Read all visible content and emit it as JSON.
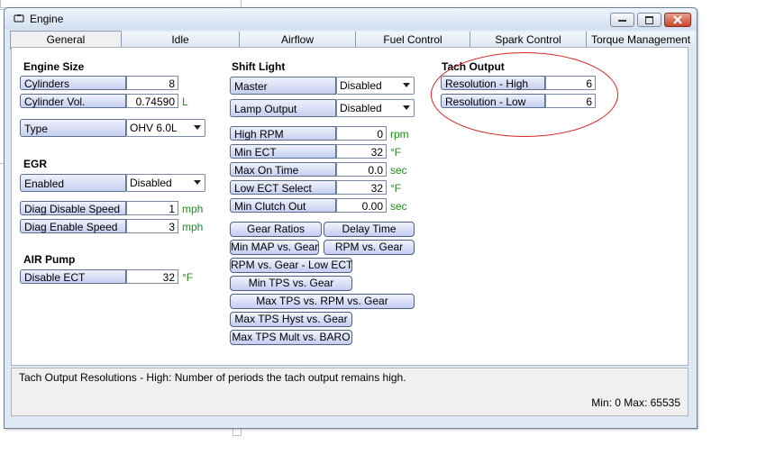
{
  "window": {
    "title": "Engine"
  },
  "tabs": [
    "General",
    "Idle",
    "Airflow",
    "Fuel Control",
    "Spark Control",
    "Torque Management"
  ],
  "engine_size": {
    "heading": "Engine Size",
    "cylinders": {
      "label": "Cylinders",
      "value": "8"
    },
    "cylinder_vol": {
      "label": "Cylinder Vol.",
      "value": "0.74590",
      "unit": "L"
    },
    "type": {
      "label": "Type",
      "value": "OHV 6.0L"
    }
  },
  "egr": {
    "heading": "EGR",
    "enabled": {
      "label": "Enabled",
      "value": "Disabled"
    },
    "diag_disable_speed": {
      "label": "Diag Disable Speed",
      "value": "1",
      "unit": "mph"
    },
    "diag_enable_speed": {
      "label": "Diag Enable Speed",
      "value": "3",
      "unit": "mph"
    }
  },
  "air_pump": {
    "heading": "AIR Pump",
    "disable_ect": {
      "label": "Disable ECT",
      "value": "32",
      "unit": "°F"
    }
  },
  "shift_light": {
    "heading": "Shift Light",
    "master": {
      "label": "Master",
      "value": "Disabled"
    },
    "lamp_output": {
      "label": "Lamp Output",
      "value": "Disabled"
    },
    "high_rpm": {
      "label": "High RPM",
      "value": "0",
      "unit": "rpm"
    },
    "min_ect": {
      "label": "Min ECT",
      "value": "32",
      "unit": "°F"
    },
    "max_on_time": {
      "label": "Max On Time",
      "value": "0.0",
      "unit": "sec"
    },
    "low_ect_select": {
      "label": "Low ECT Select",
      "value": "32",
      "unit": "°F"
    },
    "min_clutch_out": {
      "label": "Min Clutch Out",
      "value": "0.00",
      "unit": "sec"
    },
    "buttons": {
      "gear_ratios": "Gear Ratios",
      "delay_time": "Delay Time",
      "min_map_vs_gear": "Min MAP vs. Gear",
      "rpm_vs_gear": "RPM vs. Gear",
      "rpm_vs_gear_low_ect": "RPM vs. Gear - Low ECT",
      "min_tps_vs_gear": "Min TPS vs. Gear",
      "max_tps_vs_rpm_vs_gear": "Max TPS vs. RPM vs. Gear",
      "max_tps_hyst_vs_gear": "Max TPS Hyst vs. Gear",
      "max_tps_mult_vs_baro": "Max TPS Mult vs. BARO"
    }
  },
  "tach_output": {
    "heading": "Tach Output",
    "resolution_high": {
      "label": "Resolution - High",
      "value": "6"
    },
    "resolution_low": {
      "label": "Resolution - Low",
      "value": "6"
    }
  },
  "status": {
    "description": "Tach Output Resolutions - High: Number of periods the tach output remains high.",
    "range": "Min: 0 Max: 65535"
  },
  "colors": {
    "unit": "#1f8a1f",
    "highlight_oval": "#d22424"
  }
}
